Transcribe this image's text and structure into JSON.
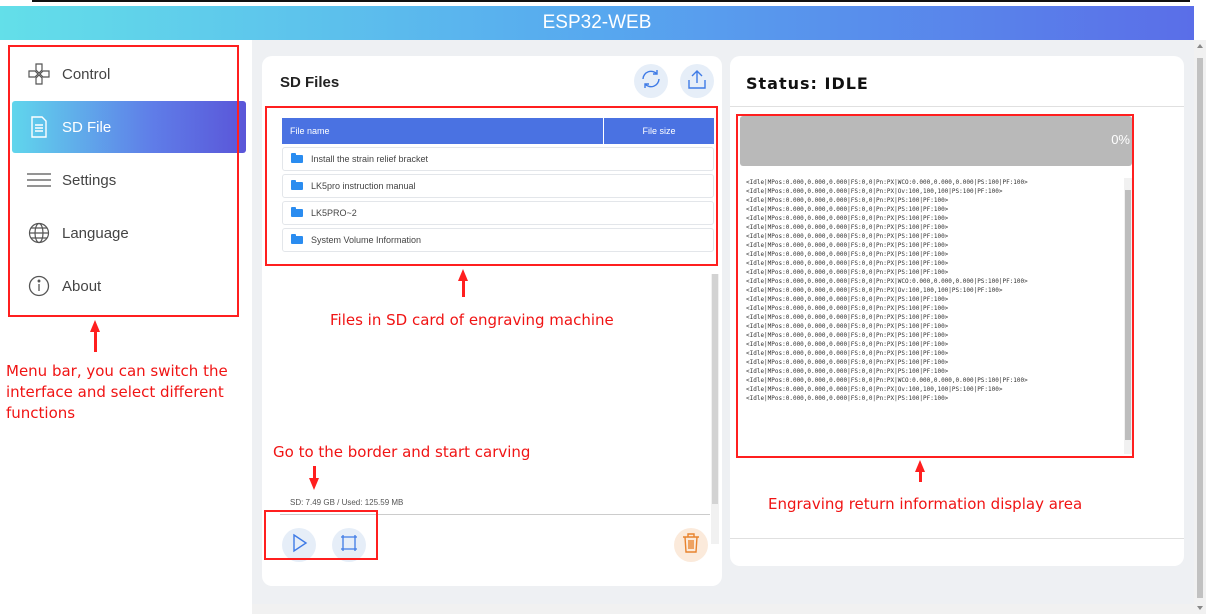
{
  "app": {
    "title": "ESP32-WEB"
  },
  "sidebar": {
    "items": [
      {
        "label": "Control",
        "icon": "gamepad-icon",
        "active": false
      },
      {
        "label": "SD File",
        "icon": "document-icon",
        "active": true
      },
      {
        "label": "Settings",
        "icon": "sliders-icon",
        "active": false
      },
      {
        "label": "Language",
        "icon": "globe-icon",
        "active": false
      },
      {
        "label": "About",
        "icon": "info-icon",
        "active": false
      }
    ]
  },
  "files_panel": {
    "title": "SD Files",
    "refresh_icon": "refresh-icon",
    "upload_icon": "upload-icon",
    "columns": [
      "File name",
      "File size"
    ],
    "rows": [
      {
        "name": "Install the strain relief bracket",
        "size": ""
      },
      {
        "name": "LK5pro instruction manual",
        "size": ""
      },
      {
        "name": "LK5PRO~2",
        "size": ""
      },
      {
        "name": "System Volume Information",
        "size": ""
      }
    ],
    "sd_info": "SD: 7.49 GB  /  Used: 125.59 MB",
    "play_icon": "play-icon",
    "frame_icon": "frame-icon",
    "delete_icon": "trash-icon"
  },
  "status_panel": {
    "title": "Status: IDLE",
    "progress_percent": 0,
    "progress_label": "0%",
    "log": [
      "<Idle|MPos:0.000,0.000,0.000|FS:0,0|Pn:PX|WCO:0.000,0.000,0.000|PS:100|PF:100>",
      "<Idle|MPos:0.000,0.000,0.000|FS:0,0|Pn:PX|Ov:100,100,100|PS:100|PF:100>",
      "<Idle|MPos:0.000,0.000,0.000|FS:0,0|Pn:PX|PS:100|PF:100>",
      "<Idle|MPos:0.000,0.000,0.000|FS:0,0|Pn:PX|PS:100|PF:100>",
      "<Idle|MPos:0.000,0.000,0.000|FS:0,0|Pn:PX|PS:100|PF:100>",
      "<Idle|MPos:0.000,0.000,0.000|FS:0,0|Pn:PX|PS:100|PF:100>",
      "<Idle|MPos:0.000,0.000,0.000|FS:0,0|Pn:PX|PS:100|PF:100>",
      "<Idle|MPos:0.000,0.000,0.000|FS:0,0|Pn:PX|PS:100|PF:100>",
      "<Idle|MPos:0.000,0.000,0.000|FS:0,0|Pn:PX|PS:100|PF:100>",
      "<Idle|MPos:0.000,0.000,0.000|FS:0,0|Pn:PX|PS:100|PF:100>",
      "<Idle|MPos:0.000,0.000,0.000|FS:0,0|Pn:PX|PS:100|PF:100>",
      "<Idle|MPos:0.000,0.000,0.000|FS:0,0|Pn:PX|WCO:0.000,0.000,0.000|PS:100|PF:100>",
      "<Idle|MPos:0.000,0.000,0.000|FS:0,0|Pn:PX|Ov:100,100,100|PS:100|PF:100>",
      "<Idle|MPos:0.000,0.000,0.000|FS:0,0|Pn:PX|PS:100|PF:100>",
      "<Idle|MPos:0.000,0.000,0.000|FS:0,0|Pn:PX|PS:100|PF:100>",
      "<Idle|MPos:0.000,0.000,0.000|FS:0,0|Pn:PX|PS:100|PF:100>",
      "<Idle|MPos:0.000,0.000,0.000|FS:0,0|Pn:PX|PS:100|PF:100>",
      "<Idle|MPos:0.000,0.000,0.000|FS:0,0|Pn:PX|PS:100|PF:100>",
      "<Idle|MPos:0.000,0.000,0.000|FS:0,0|Pn:PX|PS:100|PF:100>",
      "<Idle|MPos:0.000,0.000,0.000|FS:0,0|Pn:PX|PS:100|PF:100>",
      "<Idle|MPos:0.000,0.000,0.000|FS:0,0|Pn:PX|PS:100|PF:100>",
      "<Idle|MPos:0.000,0.000,0.000|FS:0,0|Pn:PX|PS:100|PF:100>",
      "<Idle|MPos:0.000,0.000,0.000|FS:0,0|Pn:PX|WCO:0.000,0.000,0.000|PS:100|PF:100>",
      "<Idle|MPos:0.000,0.000,0.000|FS:0,0|Pn:PX|Ov:100,100,100|PS:100|PF:100>",
      "<Idle|MPos:0.000,0.000,0.000|FS:0,0|Pn:PX|PS:100|PF:100>"
    ]
  },
  "annotations": {
    "menu_bar": [
      "Menu bar, you can switch the",
      "interface and select different",
      "functions"
    ],
    "sd_files": "Files in SD card of engraving machine",
    "border_carving": "Go to the border and start carving",
    "return_info": "Engraving return information display area"
  },
  "colors": {
    "header_gradient_start": "#63dfe9",
    "header_gradient_end": "#5a6ee8",
    "table_header": "#4a72e2",
    "annotation_red": "#ff1f1f",
    "trash_orange": "#e8832e"
  }
}
